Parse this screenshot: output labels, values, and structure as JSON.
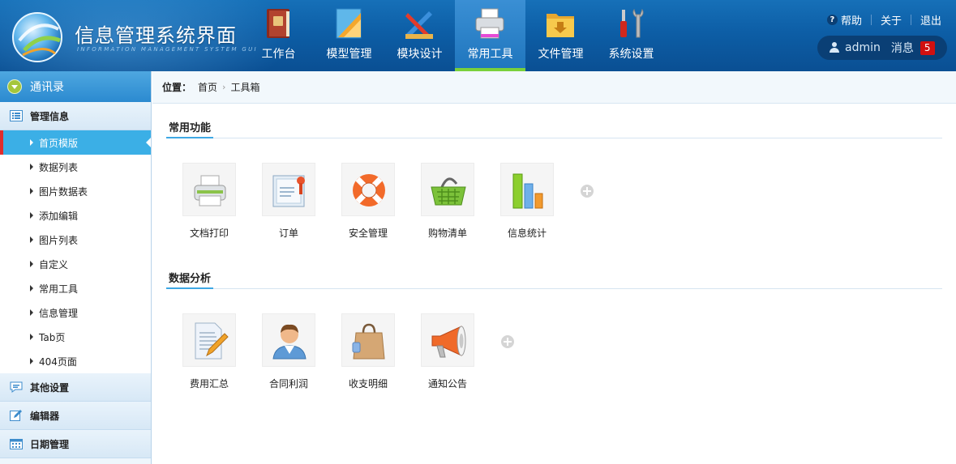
{
  "header": {
    "title": "信息管理系统界面",
    "subtitle": "INFORMATION MANAGEMENT SYSTEM GUI",
    "nav": [
      {
        "label": "工作台",
        "icon": "book-icon"
      },
      {
        "label": "模型管理",
        "icon": "ruler-icon"
      },
      {
        "label": "模块设计",
        "icon": "design-tools-icon"
      },
      {
        "label": "常用工具",
        "icon": "printer-icon",
        "active": true
      },
      {
        "label": "文件管理",
        "icon": "folder-icon"
      },
      {
        "label": "系统设置",
        "icon": "tools-icon"
      }
    ],
    "links": {
      "help": "帮助",
      "about": "关于",
      "logout": "退出"
    },
    "user": {
      "name": "admin",
      "message_label": "消息",
      "message_count": "5"
    }
  },
  "sidebar": {
    "section": "通讯录",
    "group_main": "管理信息",
    "items": [
      {
        "label": "首页模版",
        "active": true
      },
      {
        "label": "数据列表"
      },
      {
        "label": "图片数据表"
      },
      {
        "label": "添加编辑"
      },
      {
        "label": "图片列表"
      },
      {
        "label": "自定义"
      },
      {
        "label": "常用工具"
      },
      {
        "label": "信息管理"
      },
      {
        "label": "Tab页"
      },
      {
        "label": "404页面"
      }
    ],
    "group_other": "其他设置",
    "group_editor": "编辑器",
    "group_date": "日期管理"
  },
  "breadcrumb": {
    "prefix": "位置：",
    "home": "首页",
    "current": "工具箱"
  },
  "sections": {
    "common": {
      "title": "常用功能",
      "tiles": [
        {
          "label": "文档打印",
          "icon": "printer-icon"
        },
        {
          "label": "订单",
          "icon": "certificate-icon"
        },
        {
          "label": "安全管理",
          "icon": "lifebuoy-icon"
        },
        {
          "label": "购物清单",
          "icon": "basket-icon"
        },
        {
          "label": "信息统计",
          "icon": "bar-chart-icon"
        }
      ]
    },
    "analysis": {
      "title": "数据分析",
      "tiles": [
        {
          "label": "费用汇总",
          "icon": "document-pencil-icon"
        },
        {
          "label": "合同利润",
          "icon": "person-icon"
        },
        {
          "label": "收支明细",
          "icon": "shopping-bag-icon"
        },
        {
          "label": "通知公告",
          "icon": "megaphone-icon"
        }
      ]
    }
  },
  "colors": {
    "header": "#0d5ea6",
    "nav_active": "#2f86cc",
    "nav_active_bar": "#7ad13b",
    "sidebar_active": "#3bafe6",
    "badge": "#d11010"
  }
}
